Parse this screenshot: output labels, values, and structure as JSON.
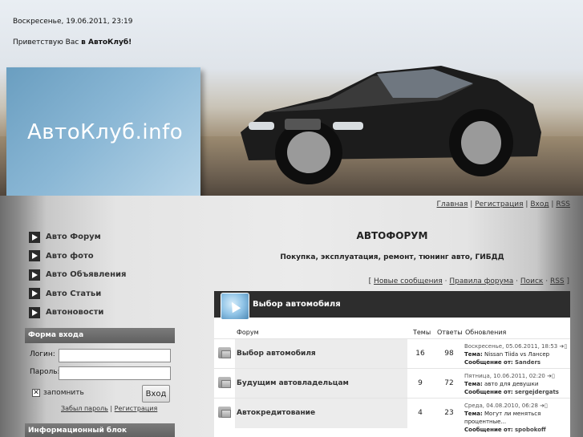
{
  "header": {
    "datetime": "Воскресенье, 19.06.2011, 23:19",
    "greeting_prefix": "Приветствую Вас ",
    "greeting_bold": "в АвтоКлуб!",
    "logo": "АвтоКлуб.info"
  },
  "top_links": [
    "Главная",
    "Регистрация",
    "Вход",
    "RSS"
  ],
  "menu": [
    "Авто Форум",
    "Авто фото",
    "Авто Объявления",
    "Авто Статьи",
    "Автоновости"
  ],
  "login": {
    "title": "Форма входа",
    "login_label": "Логин:",
    "password_label": "Пароль:",
    "remember_label": "запомнить",
    "button": "Вход",
    "forgot": "Забыл пароль",
    "register": "Регистрация"
  },
  "info_block_title": "Информационный блок",
  "forum": {
    "title": "АВТОФОРУМ",
    "subtitle": "Покупка, эксплуатация, ремонт, тюнинг авто, ГИБДД",
    "links": [
      "Новые сообщения",
      "Правила форума",
      "Поиск",
      "RSS"
    ],
    "section_title": "Выбор автомобиля",
    "columns": {
      "forum": "Форум",
      "topics": "Темы",
      "posts": "Ответы",
      "last": "Обновления"
    },
    "rows": [
      {
        "name": "Выбор автомобиля",
        "topics": "16",
        "posts": "98",
        "date": "Воскресенье, 05.06.2011, 18:53",
        "theme_label": "Тема:",
        "theme": "Nissan Tiida vs Лансер",
        "by_label": "Сообщение от:",
        "by": "Sanders"
      },
      {
        "name": "Будущим автовладельцам",
        "topics": "9",
        "posts": "72",
        "date": "Пятница, 10.06.2011, 02:20",
        "theme_label": "Тема:",
        "theme": "авто для девушки",
        "by_label": "Сообщение от:",
        "by": "sergejdergats"
      },
      {
        "name": "Автокредитование",
        "topics": "4",
        "posts": "23",
        "date": "Среда, 04.08.2010, 06:28",
        "theme_label": "Тема:",
        "theme": "Могут ли меняться процентные...",
        "by_label": "Сообщение от:",
        "by": "spobokoff"
      }
    ]
  }
}
